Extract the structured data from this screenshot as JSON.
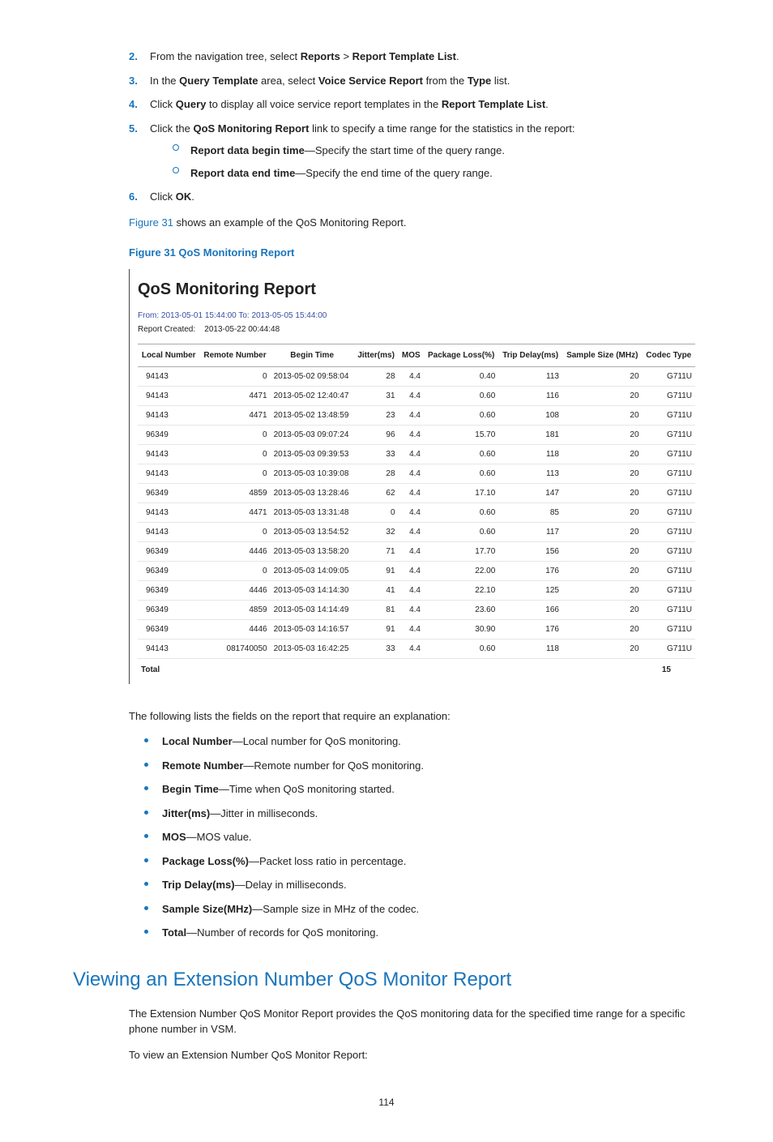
{
  "steps": [
    {
      "num": "2.",
      "pre": "From the navigation tree, select ",
      "b1": "Reports",
      "mid": " > ",
      "b2": "Report Template List",
      "post": "."
    },
    {
      "num": "3.",
      "pre": "In the ",
      "b1": "Query Template",
      "mid": " area, select ",
      "b2": "Voice Service Report",
      "post2": " from the ",
      "b3": "Type",
      "post": " list."
    },
    {
      "num": "4.",
      "pre": "Click ",
      "b1": "Query",
      "mid": " to display all voice service report templates in the ",
      "b2": "Report Template List",
      "post": "."
    },
    {
      "num": "5.",
      "pre": "Click the ",
      "b1": "QoS Monitoring Report",
      "post": " link to specify a time range for the statistics in the report:"
    },
    {
      "num": "6.",
      "pre": "Click ",
      "b1": "OK",
      "post": "."
    }
  ],
  "substeps": [
    {
      "b": "Report data begin time",
      "t": "—Specify the start time of the query range."
    },
    {
      "b": "Report data end time",
      "t": "—Specify the end time of the query range."
    }
  ],
  "fig_ref_link": "Figure 31",
  "fig_ref_rest": " shows an example of the QoS Monitoring Report.",
  "fig_caption": "Figure 31 QoS Monitoring Report",
  "report": {
    "title": "QoS Monitoring Report",
    "meta1": "From: 2013-05-01 15:44:00  To: 2013-05-05 15:44:00",
    "meta2_label": "Report Created:",
    "meta2_value": "2013-05-22 00:44:48",
    "headers": [
      "Local Number",
      "Remote Number",
      "Begin Time",
      "Jitter(ms)",
      "MOS",
      "Package Loss(%)",
      "Trip Delay(ms)",
      "Sample Size (MHz)",
      "Codec Type"
    ],
    "rows": [
      [
        "94143",
        "0",
        "2013-05-02 09:58:04",
        "28",
        "4.4",
        "0.40",
        "113",
        "20",
        "G711U"
      ],
      [
        "94143",
        "4471",
        "2013-05-02 12:40:47",
        "31",
        "4.4",
        "0.60",
        "116",
        "20",
        "G711U"
      ],
      [
        "94143",
        "4471",
        "2013-05-02 13:48:59",
        "23",
        "4.4",
        "0.60",
        "108",
        "20",
        "G711U"
      ],
      [
        "96349",
        "0",
        "2013-05-03 09:07:24",
        "96",
        "4.4",
        "15.70",
        "181",
        "20",
        "G711U"
      ],
      [
        "94143",
        "0",
        "2013-05-03 09:39:53",
        "33",
        "4.4",
        "0.60",
        "118",
        "20",
        "G711U"
      ],
      [
        "94143",
        "0",
        "2013-05-03 10:39:08",
        "28",
        "4.4",
        "0.60",
        "113",
        "20",
        "G711U"
      ],
      [
        "96349",
        "4859",
        "2013-05-03 13:28:46",
        "62",
        "4.4",
        "17.10",
        "147",
        "20",
        "G711U"
      ],
      [
        "94143",
        "4471",
        "2013-05-03 13:31:48",
        "0",
        "4.4",
        "0.60",
        "85",
        "20",
        "G711U"
      ],
      [
        "94143",
        "0",
        "2013-05-03 13:54:52",
        "32",
        "4.4",
        "0.60",
        "117",
        "20",
        "G711U"
      ],
      [
        "96349",
        "4446",
        "2013-05-03 13:58:20",
        "71",
        "4.4",
        "17.70",
        "156",
        "20",
        "G711U"
      ],
      [
        "96349",
        "0",
        "2013-05-03 14:09:05",
        "91",
        "4.4",
        "22.00",
        "176",
        "20",
        "G711U"
      ],
      [
        "96349",
        "4446",
        "2013-05-03 14:14:30",
        "41",
        "4.4",
        "22.10",
        "125",
        "20",
        "G711U"
      ],
      [
        "96349",
        "4859",
        "2013-05-03 14:14:49",
        "81",
        "4.4",
        "23.60",
        "166",
        "20",
        "G711U"
      ],
      [
        "96349",
        "4446",
        "2013-05-03 14:16:57",
        "91",
        "4.4",
        "30.90",
        "176",
        "20",
        "G711U"
      ],
      [
        "94143",
        "081740050",
        "2013-05-03 16:42:25",
        "33",
        "4.4",
        "0.60",
        "118",
        "20",
        "G711U"
      ]
    ],
    "total_label": "Total",
    "total_value": "15"
  },
  "explain_intro": "The following lists the fields on the report that require an explanation:",
  "fields": [
    {
      "b": "Local Number",
      "t": "—Local number for QoS monitoring."
    },
    {
      "b": "Remote Number",
      "t": "—Remote number for QoS monitoring."
    },
    {
      "b": "Begin Time",
      "t": "—Time when QoS monitoring started."
    },
    {
      "b": "Jitter(ms)",
      "t": "—Jitter in milliseconds."
    },
    {
      "b": "MOS",
      "t": "—MOS value."
    },
    {
      "b": "Package Loss(%)",
      "t": "—Packet loss ratio in percentage."
    },
    {
      "b": "Trip Delay(ms)",
      "t": "—Delay in milliseconds."
    },
    {
      "b": "Sample Size(MHz)",
      "t": "—Sample size in MHz of the codec."
    },
    {
      "b": "Total",
      "t": "—Number of records for QoS monitoring."
    }
  ],
  "section_title": "Viewing an Extension Number QoS Monitor Report",
  "section_p1": "The Extension Number QoS Monitor Report provides the QoS monitoring data for the specified time range for a specific phone number in VSM.",
  "section_p2": "To view an Extension Number QoS Monitor Report:",
  "page_number": "114"
}
